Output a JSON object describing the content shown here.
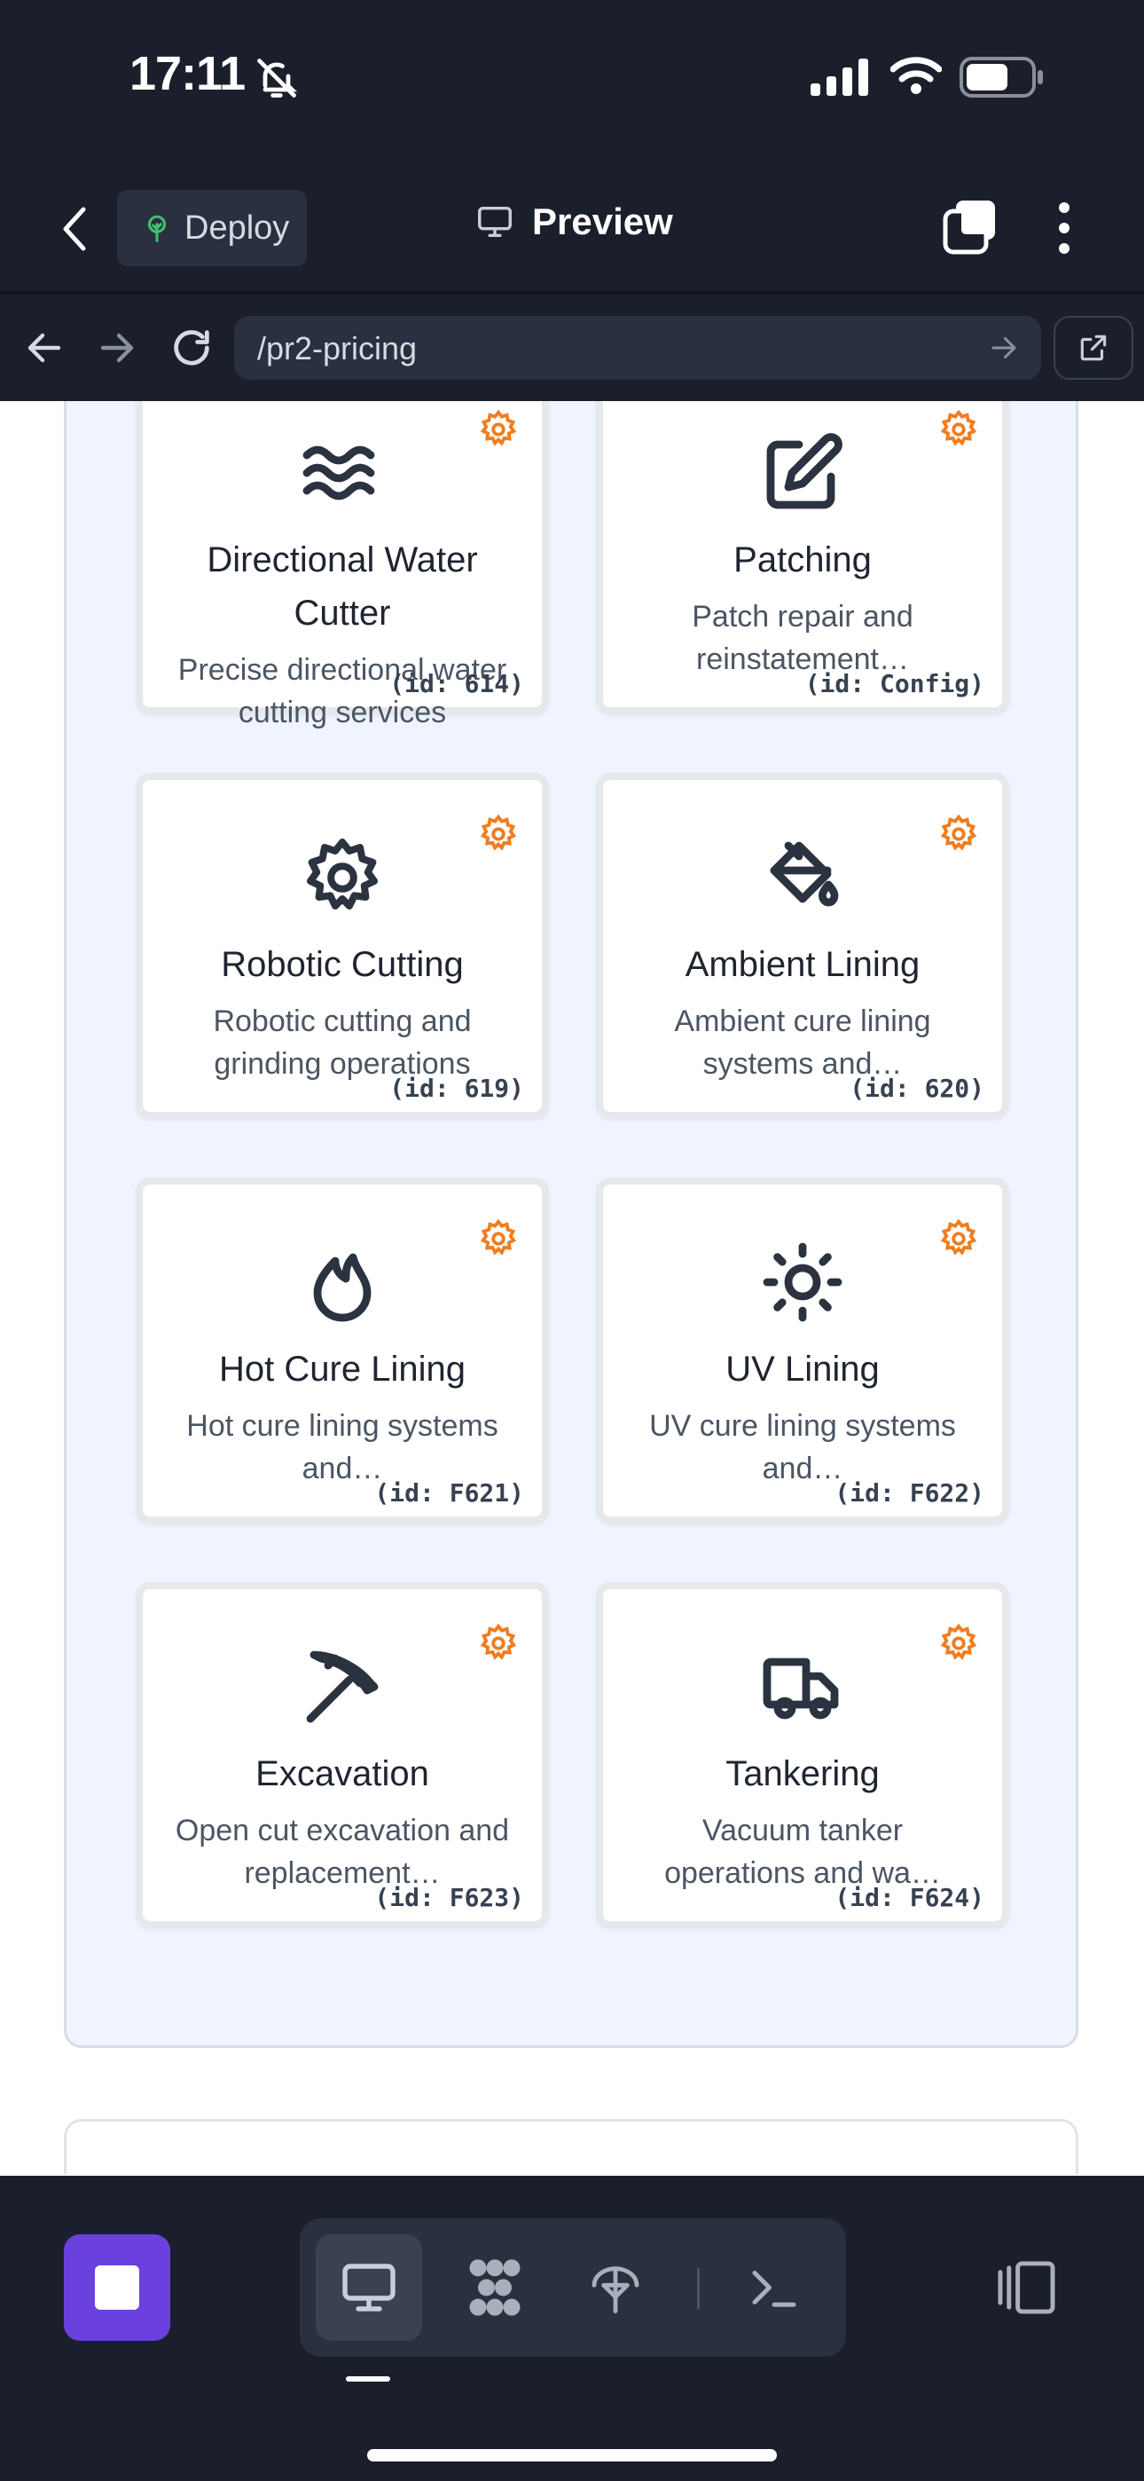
{
  "status_bar": {
    "time": "17:11"
  },
  "header": {
    "deploy_label": "Deploy",
    "preview_label": "Preview"
  },
  "browser": {
    "url": "/pr2-pricing"
  },
  "services": [
    {
      "title": "Directional Water Cutter",
      "description": "Precise directional water cutting services",
      "id_label": "(id: 614)",
      "icon": "waves-icon"
    },
    {
      "title": "Patching",
      "description": "Patch repair and reinstatement…",
      "id_label": "(id: Config)",
      "icon": "edit-icon"
    },
    {
      "title": "Robotic Cutting",
      "description": "Robotic cutting and grinding operations",
      "id_label": "(id: 619)",
      "icon": "gear-icon"
    },
    {
      "title": "Ambient Lining",
      "description": "Ambient cure lining systems and…",
      "id_label": "(id: 620)",
      "icon": "paint-bucket-icon"
    },
    {
      "title": "Hot Cure Lining",
      "description": "Hot cure lining systems and…",
      "id_label": "(id: F621)",
      "icon": "flame-icon"
    },
    {
      "title": "UV Lining",
      "description": "UV cure lining systems and…",
      "id_label": "(id: F622)",
      "icon": "sun-icon"
    },
    {
      "title": "Excavation",
      "description": "Open cut excavation and replacement…",
      "id_label": "(id: F623)",
      "icon": "pickaxe-icon"
    },
    {
      "title": "Tankering",
      "description": "Vacuum tanker operations and wa…",
      "id_label": "(id: F624)",
      "icon": "truck-icon"
    }
  ],
  "colors": {
    "accent_gear": "#f07d1e",
    "stop_button": "#6a41df",
    "panel_bg": "#eff4fe",
    "chrome_bg": "#1b1f2b"
  }
}
